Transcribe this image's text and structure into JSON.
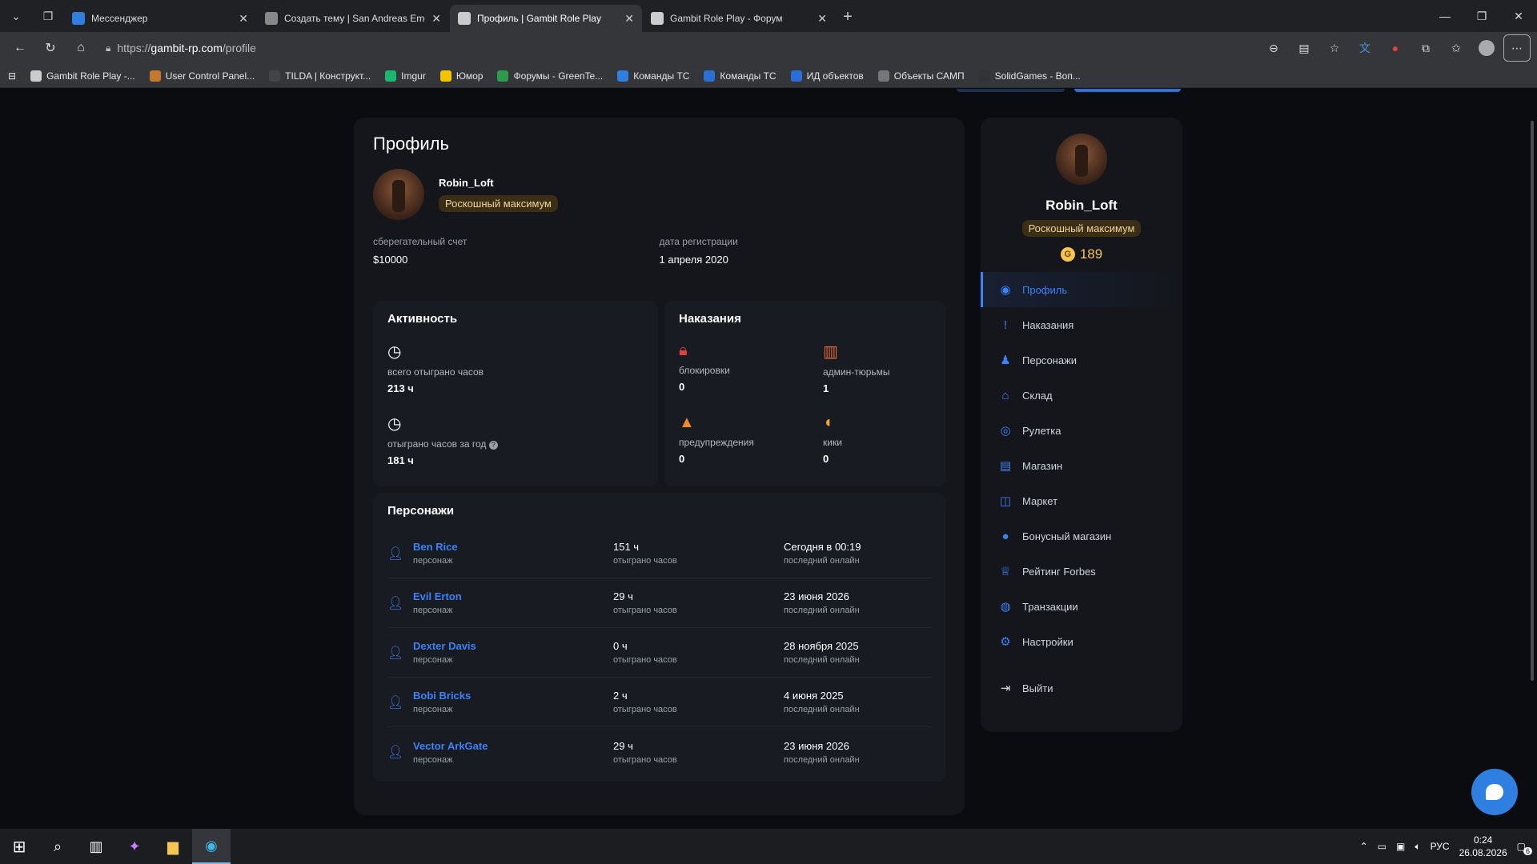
{
  "browser": {
    "tabs": [
      {
        "label": "Мессенджер",
        "active": false,
        "fav_color": "#2f7fe0"
      },
      {
        "label": "Создать тему | San Andreas Emerg",
        "active": false,
        "fav_color": "#888888"
      },
      {
        "label": "Профиль | Gambit Role Play",
        "active": true,
        "fav_color": "#cccccc"
      },
      {
        "label": "Gambit Role Play - Форум",
        "active": false,
        "fav_color": "#cccccc"
      }
    ],
    "url_scheme": "https://",
    "url_host": "gambit-rp.com",
    "url_path": "/profile",
    "bookmarks": [
      {
        "label": "Gambit Role Play -...",
        "color": "#cccccc"
      },
      {
        "label": "User Control Panel...",
        "color": "#c47a2c"
      },
      {
        "label": "TILDA | Конструкт...",
        "color": "#444444"
      },
      {
        "label": "Imgur",
        "color": "#1bb76e"
      },
      {
        "label": "Юмор",
        "color": "#f5c400"
      },
      {
        "label": "Форумы - GreenTe...",
        "color": "#2e9b4c"
      },
      {
        "label": "Команды ТС",
        "color": "#2f7fe0"
      },
      {
        "label": "Команды ТС",
        "color": "#2a6fd6"
      },
      {
        "label": "ИД объектов",
        "color": "#2a6fd6"
      },
      {
        "label": "Объекты САМП",
        "color": "#777777"
      },
      {
        "label": "SolidGames - Воп...",
        "color": "#333333"
      }
    ]
  },
  "profile": {
    "title": "Профиль",
    "name": "Robin_Loft",
    "badge": "Роскошный максимум",
    "savings_label": "сберегательный счет",
    "savings_value": "$10000",
    "reg_label": "дата регистрации",
    "reg_value": "1 апреля 2020"
  },
  "activity": {
    "title": "Активность",
    "items": [
      {
        "label": "всего отыграно часов",
        "value": "213 ч"
      },
      {
        "label": "отыграно часов за год",
        "value": "181 ч"
      }
    ]
  },
  "punishments": {
    "title": "Наказания",
    "items": [
      {
        "label": "блокировки",
        "value": "0",
        "icon": "lock-icon",
        "color": "#e0413a"
      },
      {
        "label": "админ-тюрьмы",
        "value": "1",
        "icon": "jail-icon",
        "color": "#e06a2a"
      },
      {
        "label": "предупреждения",
        "value": "0",
        "icon": "warning-icon",
        "color": "#f08a24"
      },
      {
        "label": "кики",
        "value": "0",
        "icon": "kick-icon",
        "color": "#f5a623"
      }
    ]
  },
  "characters": {
    "title": "Персонажи",
    "sub_label": "персонаж",
    "hours_label": "отыграно часов",
    "online_label": "последний онлайн",
    "rows": [
      {
        "name": "Ben Rice",
        "hours": "151 ч",
        "last": "Сегодня в 00:19"
      },
      {
        "name": "Evil Erton",
        "hours": "29 ч",
        "last": "23 июня 2026"
      },
      {
        "name": "Dexter Davis",
        "hours": "0 ч",
        "last": "28 ноября 2025"
      },
      {
        "name": "Bobi Bricks",
        "hours": "2 ч",
        "last": "4 июня 2025"
      },
      {
        "name": "Vector ArkGate",
        "hours": "29 ч",
        "last": "23 июня 2026"
      }
    ]
  },
  "sidebar": {
    "name": "Robin_Loft",
    "badge": "Роскошный максимум",
    "coins": "189",
    "coin_symbol": "G",
    "menu": [
      {
        "label": "Профиль",
        "icon": "user-circle-icon",
        "active": true
      },
      {
        "label": "Наказания",
        "icon": "alert-icon",
        "active": false
      },
      {
        "label": "Персонажи",
        "icon": "person-icon",
        "active": false
      },
      {
        "label": "Склад",
        "icon": "warehouse-icon",
        "active": false
      },
      {
        "label": "Рулетка",
        "icon": "roulette-icon",
        "active": false
      },
      {
        "label": "Магазин",
        "icon": "store-icon",
        "active": false
      },
      {
        "label": "Маркет",
        "icon": "bag-icon",
        "active": false
      },
      {
        "label": "Бонусный магазин",
        "icon": "bonus-icon",
        "active": false
      },
      {
        "label": "Рейтинг Forbes",
        "icon": "trophy-icon",
        "active": false
      },
      {
        "label": "Транзакции",
        "icon": "transactions-icon",
        "active": false
      },
      {
        "label": "Настройки",
        "icon": "gear-icon",
        "active": false
      }
    ],
    "logout": "Выйти"
  },
  "taskbar": {
    "lang": "РУС",
    "time": "0:24",
    "date": "26.08.2026",
    "notif_count": "6"
  },
  "colors": {
    "accent": "#3b82f6",
    "gold": "#f5c451"
  }
}
